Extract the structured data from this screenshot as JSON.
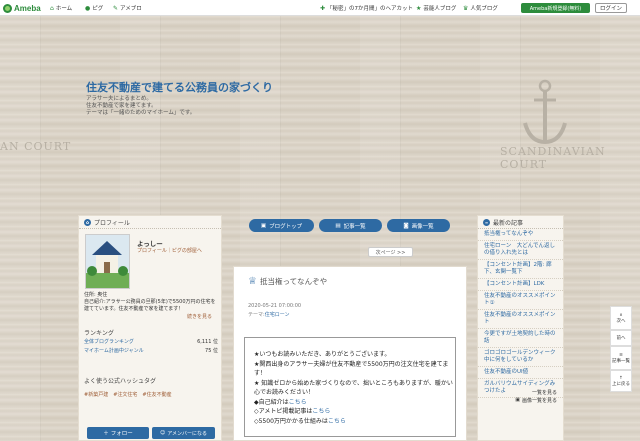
{
  "topbar": {
    "brand": "Ameba",
    "nav_home": "ホーム",
    "nav_pigg": "ピグ",
    "nav_apps": "アメブロ",
    "right_links": [
      "「秘密」の7か月間」のヘアカット",
      "芸能人ブログ",
      "人気ブログ"
    ],
    "register": "Ameba新規登録(無料)",
    "login": "ログイン"
  },
  "header": {
    "title": "住友不動産で建てる公務員の家づくり",
    "desc_lines": [
      "アラサー夫によるまとめ。",
      "住友不動産で家を建てます。",
      "テーマは「一緒のためのマイホーム」です。"
    ],
    "court_left": "AN COURT",
    "court_right": "SCANDINAVIAN COURT"
  },
  "profile": {
    "heading": "プロフィール",
    "name": "よっしー",
    "sub": "プロフィール｜ピグの部屋へ",
    "intro": "住所: 奥住\n自己紹介:アラサー公務員の旦那(5年)で5500万円の住宅を建てています。住友不動産で家を建てます！",
    "more": "続きを見る",
    "ranking_heading": "ランキング",
    "rank1_label": "全体ブログランキング",
    "rank1_value": "6,111 位",
    "rank2_label": "マイホーム計画中ジャンル",
    "rank2_value": "75 位",
    "hashtag_heading": "よく使う公式ハッシュタグ",
    "hashtags": [
      "#新築戸建",
      "#注文住宅",
      "#住友不動産"
    ],
    "follow": "フォロー",
    "amember": "アメンバーになる"
  },
  "tabs": {
    "blog_top": "ブログトップ",
    "articles": "記事一覧",
    "images": "画像一覧"
  },
  "next_page": "次ページ >>",
  "article": {
    "title": "抵当権ってなんぞや",
    "date": "2020-05-21 07:00:00",
    "theme_label": "テーマ:",
    "theme": "住宅ローン",
    "body": [
      "★いつもお読みいただき、ありがとうございます。",
      "★関西出身のアラサー夫婦が住友不動産で5500万円の注文住宅を建てます！",
      "★ 知識ゼロから始めた家づくりなので、拙いところもありますが、暖かい心でお読みください！",
      "",
      "◆自己紹介は",
      "◇アメトピ掲載記事は",
      "◇5500万円かかる仕組みは"
    ],
    "link_word": "こちら"
  },
  "recent": {
    "heading": "最新の記事",
    "items": [
      "抵当権ってなんぞや",
      "住宅ローン　大どんでん返しの借り入れ先とは",
      "【コンセント計画】2階: 廊下、玄関一覧下",
      "【コンセント計画】LDK",
      "住友不動産のオススメポイント①",
      "住友不動産のオススメポイント",
      "今更ですが土地契約した時の話",
      "ゴロゴロゴールデンウィーク中に何をしているか",
      "住友不動産のUI値",
      "ガルバリウムサイディングみつけたよ"
    ],
    "list_link": "一覧を見る",
    "image_link": "画像一覧を見る"
  },
  "sidetools": {
    "next": "次へ",
    "prev": "前へ",
    "articles": "記事一覧",
    "top": "上に戻る"
  }
}
